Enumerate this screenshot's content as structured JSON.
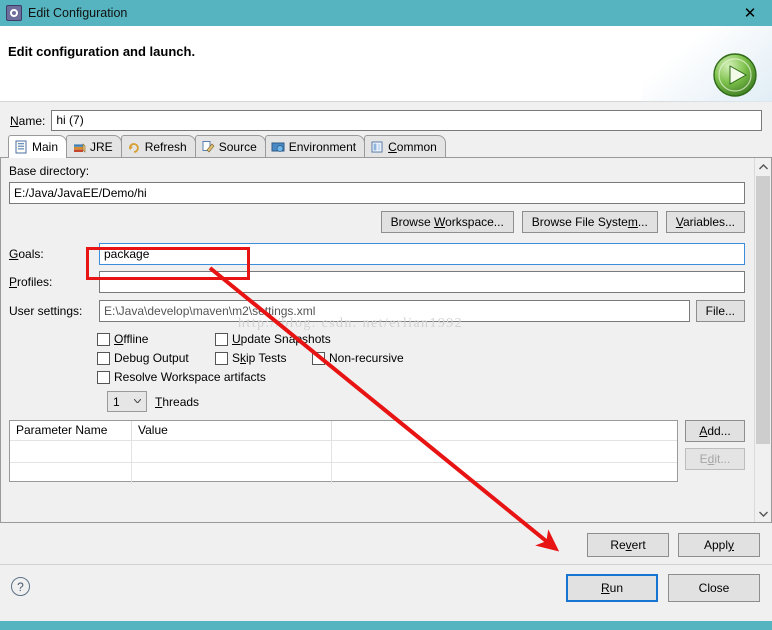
{
  "window": {
    "title": "Edit Configuration",
    "title_icon": "gear-icon",
    "close_label": "✕",
    "accent_color": "#55b4bf"
  },
  "header": {
    "headline": "Edit configuration and launch.",
    "badge_icon": "run-play-icon"
  },
  "name_field": {
    "label": "Name:",
    "value": "hi (7)"
  },
  "tabs": [
    {
      "label": "Main",
      "icon": "document-icon",
      "active": true
    },
    {
      "label": "JRE",
      "icon": "books-icon",
      "active": false
    },
    {
      "label": "Refresh",
      "icon": "refresh-icon",
      "active": false
    },
    {
      "label": "Source",
      "icon": "source-icon",
      "active": false
    },
    {
      "label": "Environment",
      "icon": "environment-icon",
      "active": false
    },
    {
      "label": "Common",
      "icon": "common-icon",
      "active": false
    }
  ],
  "main": {
    "base_directory": {
      "label": "Base directory:",
      "value": "E:/Java/JavaEE/Demo/hi"
    },
    "browse_buttons": [
      {
        "label": "Browse Workspace..."
      },
      {
        "label": "Browse File System..."
      },
      {
        "label": "Variables..."
      }
    ],
    "goals": {
      "label": "Goals:",
      "value": "package",
      "highlighted": true
    },
    "profiles": {
      "label": "Profiles:",
      "value": ""
    },
    "user_settings": {
      "label": "User settings:",
      "value": "E:\\Java\\develop\\maven\\m2\\settings.xml",
      "button_label": "File..."
    },
    "checkboxes": [
      {
        "label": "Offline",
        "checked": false
      },
      {
        "label": "Update Snapshots",
        "checked": false
      },
      {
        "label": "Debug Output",
        "checked": false
      },
      {
        "label": "Skip Tests",
        "checked": false
      },
      {
        "label": "Non-recursive",
        "checked": false
      },
      {
        "label": "Resolve Workspace artifacts",
        "checked": false
      }
    ],
    "threads": {
      "value": "1",
      "label": "Threads"
    },
    "parameters_table": {
      "columns": [
        "Parameter Name",
        "Value"
      ],
      "rows": []
    },
    "table_buttons": [
      {
        "label": "Add...",
        "enabled": true
      },
      {
        "label": "Edit...",
        "enabled": false
      }
    ]
  },
  "apply_bar": {
    "revert_label": "Revert",
    "apply_label": "Apply"
  },
  "footer": {
    "help_label": "?",
    "run_label": "Run",
    "close_label": "Close"
  },
  "annotations": {
    "watermark": "http://blog. csdn. net/erlian1992",
    "highlight_color": "#e81313"
  }
}
